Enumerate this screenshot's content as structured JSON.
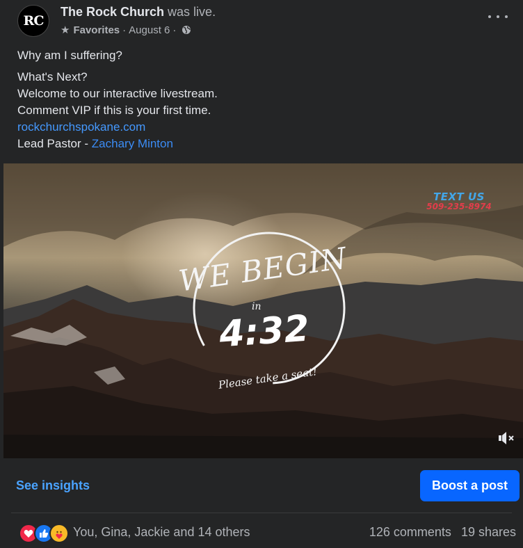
{
  "post": {
    "avatar_text": "RC",
    "page_name": "The Rock Church",
    "status_text": "was live.",
    "list_label": "Favorites",
    "separator": "·",
    "date": "August 6",
    "audience_icon": "globe-icon",
    "more_icon": "more-options-icon"
  },
  "caption": {
    "line1": "Why am I suffering?",
    "line2": "What's Next?",
    "line3": "Welcome to our interactive livestream.",
    "line4": "Comment VIP if this is your first time.",
    "link": "rockchurchspokane.com",
    "pastor_prefix": "Lead Pastor - ",
    "pastor_name": "Zachary Minton"
  },
  "video": {
    "title_text": "WE BEGIN",
    "in_text": "in",
    "time": "4:32",
    "subtitle": "Please take a seat!",
    "text_us_title": "TEXT US",
    "text_us_phone": "509-235-8974",
    "mute_icon": "speaker-muted-icon"
  },
  "actions": {
    "insights_label": "See insights",
    "boost_label": "Boost a post"
  },
  "engagement": {
    "reactions": [
      "love",
      "like",
      "care"
    ],
    "reactors": "You, Gina, Jackie and 14 others",
    "comments": "126 comments",
    "shares": "19 shares"
  },
  "colors": {
    "background": "#242526",
    "link": "#4599ff",
    "boost_button": "#0866ff",
    "love": "#f0284a",
    "like": "#1877f2",
    "care": "#f7b928"
  }
}
